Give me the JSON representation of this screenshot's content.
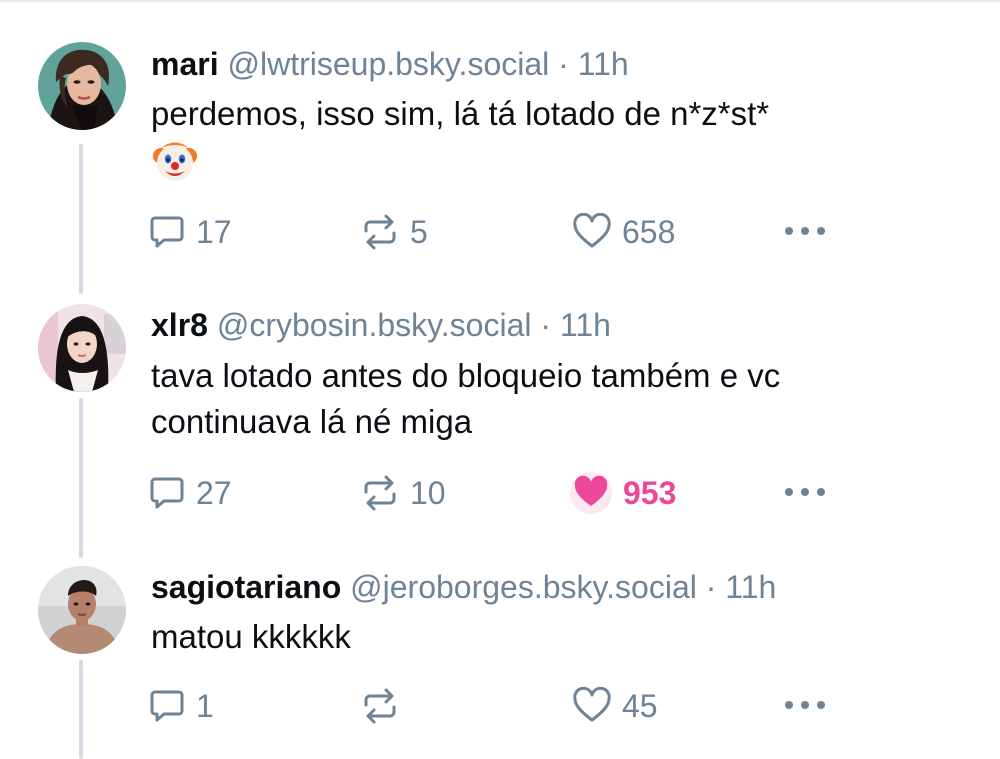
{
  "posts": [
    {
      "display_name": "mari",
      "handle": "@lwtriseup.bsky.social",
      "separator": "·",
      "time": "11h",
      "text_lines": [
        "perdemos, isso sim, lá tá lotado de n*z*st*"
      ],
      "emoji": "clown-face",
      "replies": "17",
      "reposts": "5",
      "likes": "658",
      "liked": false
    },
    {
      "display_name": "xlr8",
      "handle": "@crybosin.bsky.social",
      "separator": "·",
      "time": "11h",
      "text_lines": [
        "tava lotado antes do bloqueio também e vc",
        "continuava lá né miga"
      ],
      "replies": "27",
      "reposts": "10",
      "likes": "953",
      "liked": true
    },
    {
      "display_name": "sagiotariano",
      "handle": "@jeroborges.bsky.social",
      "separator": "·",
      "time": "11h",
      "text_lines": [
        "matou kkkkkk"
      ],
      "replies": "1",
      "reposts": "",
      "likes": "45",
      "liked": false
    }
  ],
  "icons": {
    "reply": "speech-bubble-icon",
    "repost": "repost-arrows-icon",
    "like": "heart-icon",
    "more": "more-dots-icon"
  },
  "colors": {
    "muted": "#6f8396",
    "like_active": "#ec4899",
    "thread_line": "#d4dbe2"
  }
}
